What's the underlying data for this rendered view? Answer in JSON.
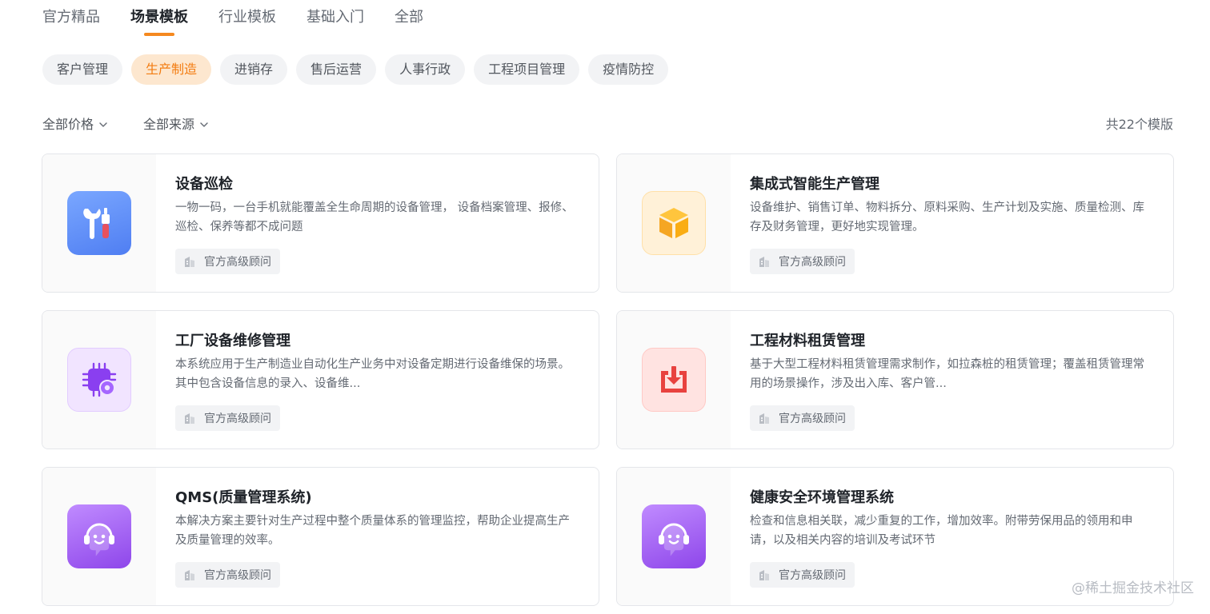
{
  "top_tabs": [
    {
      "label": "官方精品"
    },
    {
      "label": "场景模板"
    },
    {
      "label": "行业模板"
    },
    {
      "label": "基础入门"
    },
    {
      "label": "全部"
    }
  ],
  "active_top_tab": "场景模板",
  "categories": [
    {
      "label": "客户管理"
    },
    {
      "label": "生产制造"
    },
    {
      "label": "进销存"
    },
    {
      "label": "售后运营"
    },
    {
      "label": "人事行政"
    },
    {
      "label": "工程项目管理"
    },
    {
      "label": "疫情防控"
    }
  ],
  "active_category": "生产制造",
  "filters": {
    "price": "全部价格",
    "source": "全部来源",
    "chevron_icon": "chevron-down-icon"
  },
  "total_text": "共22个模版",
  "cards": [
    {
      "title": "设备巡检",
      "desc": "一物一码，一台手机就能覆盖全生命周期的设备管理， 设备档案管理、报修、巡检、保养等都不成问题",
      "badge": "官方高级顾问",
      "icon": "wrench-screwdriver-icon"
    },
    {
      "title": "集成式智能生产管理",
      "desc": "设备维护、销售订单、物料拆分、原料采购、生产计划及实施、质量检测、库存及财务管理，更好地实现管理。",
      "badge": "官方高级顾问",
      "icon": "cube-icon"
    },
    {
      "title": "工厂设备维修管理",
      "desc": "本系统应用于生产制造业自动化生产业务中对设备定期进行设备维保的场景。 其中包含设备信息的录入、设备维...",
      "badge": "官方高级顾问",
      "icon": "chip-gear-icon"
    },
    {
      "title": "工程材料租赁管理",
      "desc": "基于大型工程材料租赁管理需求制作，如拉森桩的租赁管理；覆盖租赁管理常用的场景操作，涉及出入库、客户管...",
      "badge": "官方高级顾问",
      "icon": "inbox-download-icon"
    },
    {
      "title": "QMS(质量管理系统)",
      "desc": "本解决方案主要针对生产过程中整个质量体系的管理监控，帮助企业提高生产及质量管理的效率。",
      "badge": "官方高级顾问",
      "icon": "headset-smile-icon"
    },
    {
      "title": "健康安全环境管理系统",
      "desc": "检查和信息相关联，减少重复的工作，增加效率。附带劳保用品的领用和申请，以及相关内容的培训及考试环节",
      "badge": "官方高级顾问",
      "icon": "headset-smile-icon"
    }
  ],
  "watermark": "@稀土掘金技术社区",
  "colors": {
    "accent": "#f5891f",
    "active_pill_bg": "#fde7cf",
    "active_pill_text": "#f37c11"
  }
}
